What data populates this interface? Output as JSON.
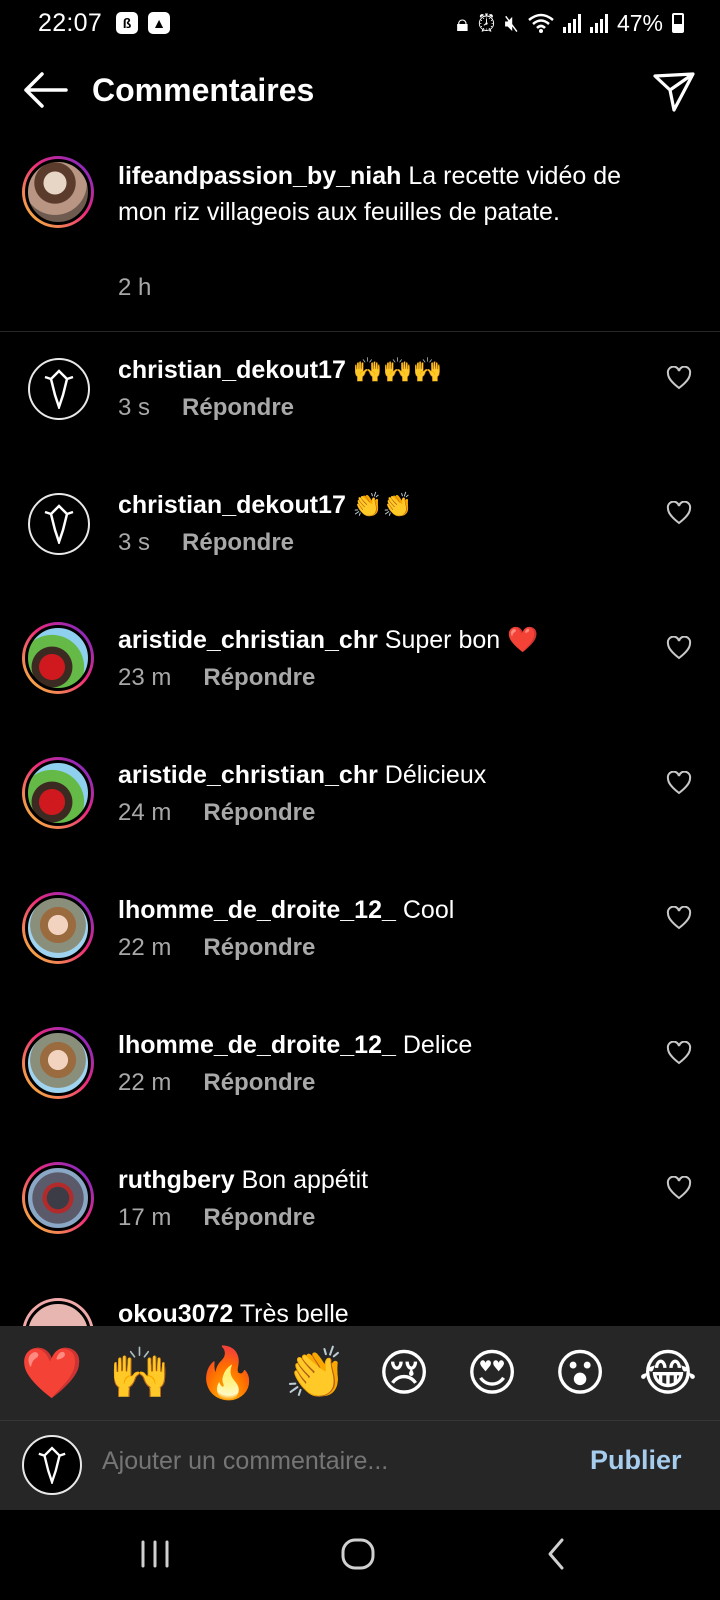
{
  "status_bar": {
    "time": "22:07",
    "battery": "47%"
  },
  "header": {
    "title": "Commentaires"
  },
  "caption": {
    "username": "lifeandpassion_by_niah",
    "text": "La recette vidéo de mon riz villageois aux feuilles de patate.",
    "time": "2 h"
  },
  "comments": [
    {
      "username": "christian_dekout17",
      "text": "🙌🙌🙌",
      "time": "3 s",
      "reply": "Répondre"
    },
    {
      "username": "christian_dekout17",
      "text": "👏👏",
      "time": "3 s",
      "reply": "Répondre"
    },
    {
      "username": "aristide_christian_chr",
      "text": "Super bon ❤️",
      "time": "23 m",
      "reply": "Répondre"
    },
    {
      "username": "aristide_christian_chr",
      "text": "Délicieux",
      "time": "24 m",
      "reply": "Répondre"
    },
    {
      "username": "lhomme_de_droite_12_",
      "text": "Cool",
      "time": "22 m",
      "reply": "Répondre"
    },
    {
      "username": "lhomme_de_droite_12_",
      "text": "Delice",
      "time": "22 m",
      "reply": "Répondre"
    },
    {
      "username": "ruthgbery",
      "text": "Bon appétit",
      "time": "17 m",
      "reply": "Répondre"
    },
    {
      "username": "okou3072",
      "text": "Très belle"
    }
  ],
  "quick_emojis": [
    "❤️",
    "🙌",
    "🔥",
    "👏",
    "😢",
    "😍",
    "😮",
    "😂"
  ],
  "input": {
    "placeholder": "Ajouter un commentaire...",
    "publish_label": "Publier"
  },
  "colors": {
    "background": "#000000",
    "bar_background": "#262626",
    "secondary_text": "#a8a8a8",
    "publish": "#a6cdee",
    "ring_gradient": [
      "#f9ce34",
      "#ee2a7b",
      "#6228d7"
    ]
  }
}
